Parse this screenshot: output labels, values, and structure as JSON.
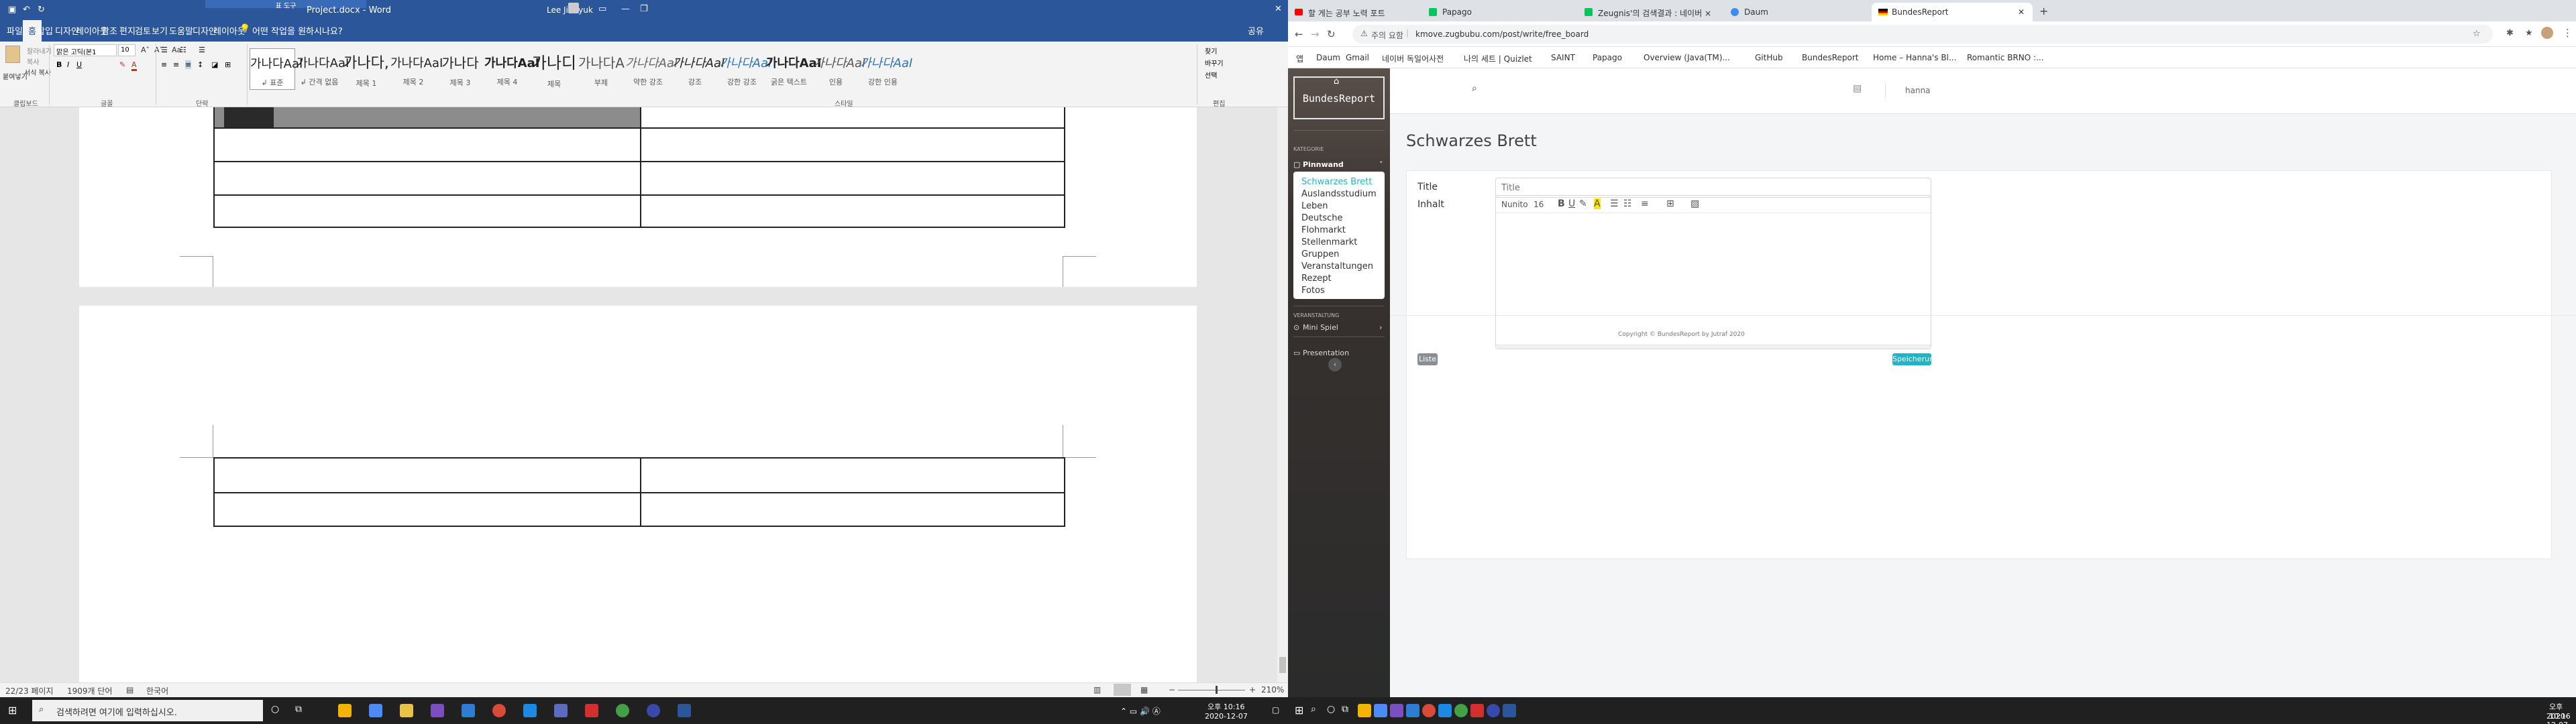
{
  "word": {
    "title_doc": "Project.docx - Word",
    "title_context": "표 도구",
    "user": "Lee Jinhyuk",
    "tabs": [
      "파일",
      "홈",
      "삽입",
      "디자인",
      "레이아웃",
      "참조",
      "편지",
      "검토",
      "보기",
      "도움말",
      "디자인",
      "레이아웃"
    ],
    "tell_me": "어떤 작업을 원하시나요?",
    "share": "공유",
    "clipboard": {
      "paste": "붙여넣기",
      "cut": "잘라내기",
      "copy": "복사",
      "format_painter": "서식 복사",
      "group": "클립보드"
    },
    "font": {
      "name": "맑은 고딕(본1",
      "size": "10",
      "group": "글꼴"
    },
    "paragraph_group": "단락",
    "styles": {
      "group": "스타일",
      "items": [
        {
          "sample": "가나다AaI",
          "label": "↲ 표준"
        },
        {
          "sample": "가나다AaI",
          "label": "↲ 간격 없음"
        },
        {
          "sample": "가나다,",
          "label": "제목 1"
        },
        {
          "sample": "가나다AaI",
          "label": "제목 2"
        },
        {
          "sample": "가나다",
          "label": "제목 3"
        },
        {
          "sample": "가나다AaI",
          "label": "제목 4"
        },
        {
          "sample": "가나디",
          "label": "제목"
        },
        {
          "sample": "가나다A",
          "label": "부제"
        },
        {
          "sample": "가나다AaI",
          "label": "약한 강조"
        },
        {
          "sample": "가나다AaI",
          "label": "강조"
        },
        {
          "sample": "가나다AaI",
          "label": "강한 강조"
        },
        {
          "sample": "가나다AaI",
          "label": "굵은 텍스트"
        },
        {
          "sample": "가나다AaI",
          "label": "인용"
        },
        {
          "sample": "가나다AaI",
          "label": "강한 인용"
        }
      ]
    },
    "editing": {
      "find": "찾기",
      "replace": "바꾸기",
      "select": "선택",
      "group": "편집"
    },
    "status": {
      "page": "22/23 페이지",
      "words": "1909개 단어",
      "lang": "한국어",
      "zoom": "210%"
    },
    "taskbar": {
      "search_placeholder": "검색하려면 여기에 입력하십시오.",
      "time": "오후 10:16",
      "date": "2020-12-07"
    }
  },
  "browser": {
    "tabs": [
      {
        "title": "할 게는 공부 노력 포트",
        "active": false,
        "color": "#ff0000"
      },
      {
        "title": "Papago",
        "active": false,
        "color": "#03c75a"
      },
      {
        "title": "Zeugnis'의 검색결과 : 네이버 ×",
        "active": false,
        "color": "#03c75a"
      },
      {
        "title": "Daum",
        "active": false,
        "color": "#3c8cf0"
      },
      {
        "title": "BundesReport",
        "active": true,
        "color": "#e6b800"
      }
    ],
    "security_label": "주의 요함",
    "url": "kmove.zugbubu.com/post/write/free_board",
    "bookmarks": [
      "앱",
      "Daum",
      "Gmail",
      "네이버 독일어사전",
      "나의 세트 | Quizlet",
      "SAINT",
      "Papago",
      "Overview (Java(TM)...",
      "GitHub",
      "BundesReport",
      "Home – Hanna's Bl...",
      "Romantic BRNO :..."
    ],
    "site": {
      "logo": "BundesReport",
      "section_category": "KATEGORIE",
      "pinnwand": "Pinnwand",
      "menu": [
        "Schwarzes Brett",
        "Auslandsstudium",
        "Leben",
        "Deutsche",
        "Flohmarkt",
        "Stellenmarkt",
        "Gruppen",
        "Veranstaltungen",
        "Rezept",
        "Fotos"
      ],
      "section_event": "VERANSTALTUNG",
      "mini_spiel": "Mini Spiel",
      "presentation": "Presentation",
      "user": "hanna",
      "page_title": "Schwarzes Brett",
      "form": {
        "title_label": "Title",
        "title_placeholder": "Title",
        "content_label": "Inhalt",
        "font": "Nunito",
        "size": "16"
      },
      "buttons": {
        "list": "Liste",
        "save": "Speicherung"
      },
      "footer": "Copyright © BundesReport by Jutraf 2020"
    },
    "taskbar": {
      "time": "오후 10:16",
      "date": "2020-12-07"
    }
  },
  "colors": {
    "word_blue": "#2b579a",
    "teal": "#1fb5c7",
    "grey_btn": "#8a8f96",
    "side_dark": "#2b2b2b"
  }
}
